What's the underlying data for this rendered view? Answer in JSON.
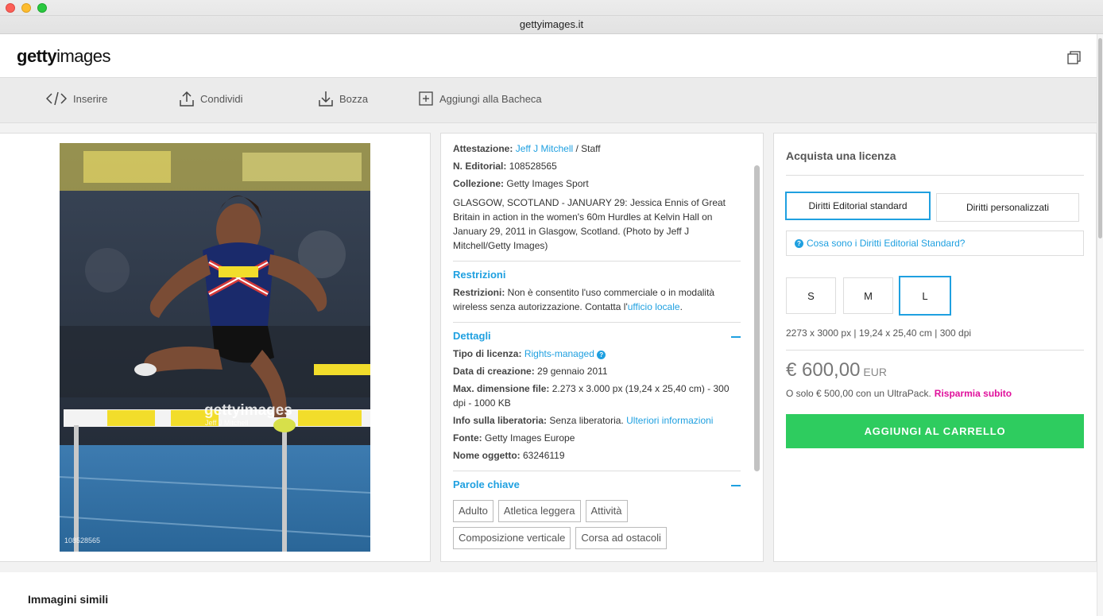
{
  "window": {
    "url": "gettyimages.it"
  },
  "header": {
    "logo_bold": "getty",
    "logo_light": "images"
  },
  "toolbar": {
    "items": [
      {
        "label": "Inserire",
        "icon": "embed-icon"
      },
      {
        "label": "Condividi",
        "icon": "share-icon"
      },
      {
        "label": "Bozza",
        "icon": "download-icon"
      },
      {
        "label": "Aggiungi alla Bacheca",
        "icon": "add-board-icon"
      }
    ]
  },
  "image": {
    "watermark": "gettyimages",
    "watermark_credit": "Jeff J Mitchell",
    "image_id": "108528565"
  },
  "info": {
    "attribution_label": "Attestazione:",
    "attribution_link": "Jeff J Mitchell",
    "attribution_rest": " / Staff",
    "editorial_label": "N. Editorial:",
    "editorial_value": "108528565",
    "collection_label": "Collezione:",
    "collection_value": "Getty Images Sport",
    "description": "GLASGOW, SCOTLAND - JANUARY 29: Jessica Ennis of Great Britain in action in the women's 60m Hurdles at Kelvin Hall on January 29, 2011 in Glasgow, Scotland. (Photo by Jeff J Mitchell/Getty Images)",
    "restrictions": {
      "title": "Restrizioni",
      "label": "Restrizioni:",
      "text": " Non è consentito l'uso commerciale o in modalità wireless senza autorizzazione. Contatta l'",
      "link": "ufficio locale",
      "end": "."
    },
    "details": {
      "title": "Dettagli",
      "license_label": "Tipo di licenza:",
      "license_value": "Rights-managed",
      "created_label": "Data di creazione:",
      "created_value": "29 gennaio 2011",
      "maxdim_label": "Max. dimensione file:",
      "maxdim_value": "2.273 x 3.000 px (19,24 x 25,40 cm) - 300 dpi - 1000 KB",
      "release_label": "Info sulla liberatoria:",
      "release_value": "Senza liberatoria.",
      "release_link": "Ulteriori informazioni",
      "source_label": "Fonte:",
      "source_value": "Getty Images Europe",
      "object_label": "Nome oggetto:",
      "object_value": "63246119"
    },
    "keywords": {
      "title": "Parole chiave",
      "tags": [
        "Adulto",
        "Atletica leggera",
        "Attività",
        "Composizione verticale",
        "Corsa ad ostacoli"
      ]
    }
  },
  "buy": {
    "title": "Acquista una licenza",
    "option_standard": "Diritti Editorial standard",
    "option_custom": "Diritti personalizzati",
    "help_link": "Cosa sono i Diritti Editorial Standard?",
    "sizes": [
      "S",
      "M",
      "L"
    ],
    "selected_size": "L",
    "dimensions": "2273 x 3000 px | 19,24 x 25,40 cm | 300 dpi",
    "price": "€ 600,00",
    "currency": "EUR",
    "ultrapack_text": "O solo € 500,00 con un UltraPack.",
    "ultrapack_link": "Risparmia subito",
    "cart_button": "AGGIUNGI AL CARRELLO"
  },
  "similar": {
    "title": "Immagini simili"
  },
  "colors": {
    "accent": "#1fa0e0",
    "cart": "#2ecc5f",
    "promo": "#e0119c"
  }
}
